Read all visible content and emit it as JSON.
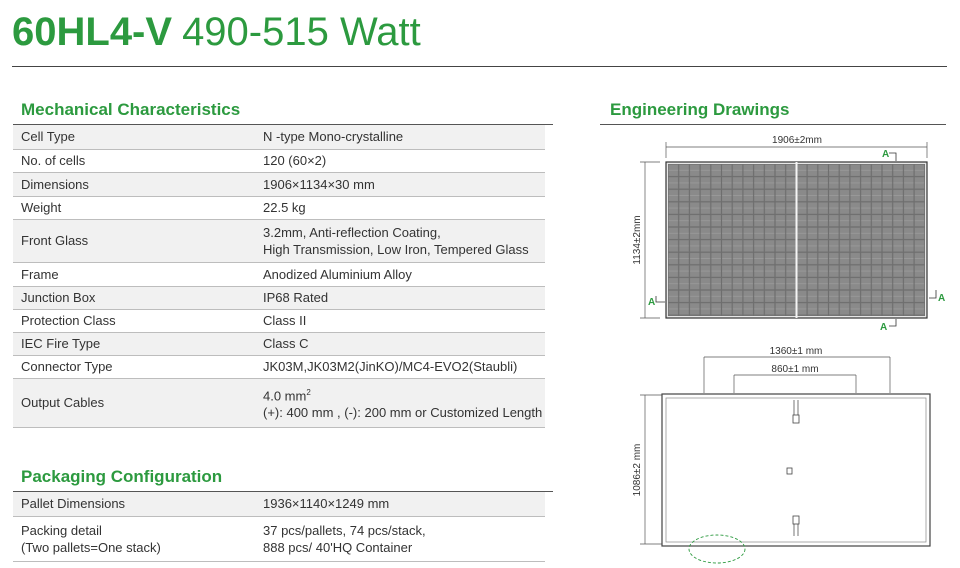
{
  "header": {
    "model": "60HL4-V",
    "power_range": "490-515 Watt"
  },
  "mechanical": {
    "title": "Mechanical Characteristics",
    "rows": [
      {
        "label": "Cell Type",
        "value": "N -type Mono-crystalline"
      },
      {
        "label": "No. of cells",
        "value": "120 (60×2)"
      },
      {
        "label": "Dimensions",
        "value": "1906×1134×30 mm"
      },
      {
        "label": "Weight",
        "value": "22.5 kg"
      },
      {
        "label": "Front Glass",
        "value": "3.2mm, Anti-reflection Coating,\nHigh Transmission, Low Iron, Tempered Glass"
      },
      {
        "label": "Frame",
        "value": "Anodized Aluminium Alloy"
      },
      {
        "label": "Junction Box",
        "value": "IP68 Rated"
      },
      {
        "label": "Protection Class",
        "value": "Class II"
      },
      {
        "label": "IEC Fire Type",
        "value": "Class C"
      },
      {
        "label": "Connector Type",
        "value": "JK03M,JK03M2(JinKO)/MC4-EVO2(Staubli)"
      },
      {
        "label": "Output Cables",
        "value_line1": "4.0 mm",
        "value_sup": "2",
        "value_line2": "(+): 400 mm , (-): 200 mm or Customized Length"
      }
    ]
  },
  "packaging": {
    "title": "Packaging Configuration",
    "rows": [
      {
        "label": "Pallet Dimensions",
        "value": "1936×1140×1249 mm"
      },
      {
        "label": "Packing detail\n(Two pallets=One stack)",
        "value": "37 pcs/pallets, 74 pcs/stack,\n888 pcs/ 40'HQ Container"
      }
    ]
  },
  "drawings": {
    "title": "Engineering Drawings",
    "front_width": "1906±2mm",
    "front_height": "1134±2mm",
    "section_marker": "A",
    "back_outer_width": "1360±1 mm",
    "back_inner_width": "860±1 mm",
    "back_height": "1086±2 mm"
  },
  "colors": {
    "accent": "#2c9a3f",
    "text": "#333333",
    "row_shade": "#f1f1f1"
  }
}
